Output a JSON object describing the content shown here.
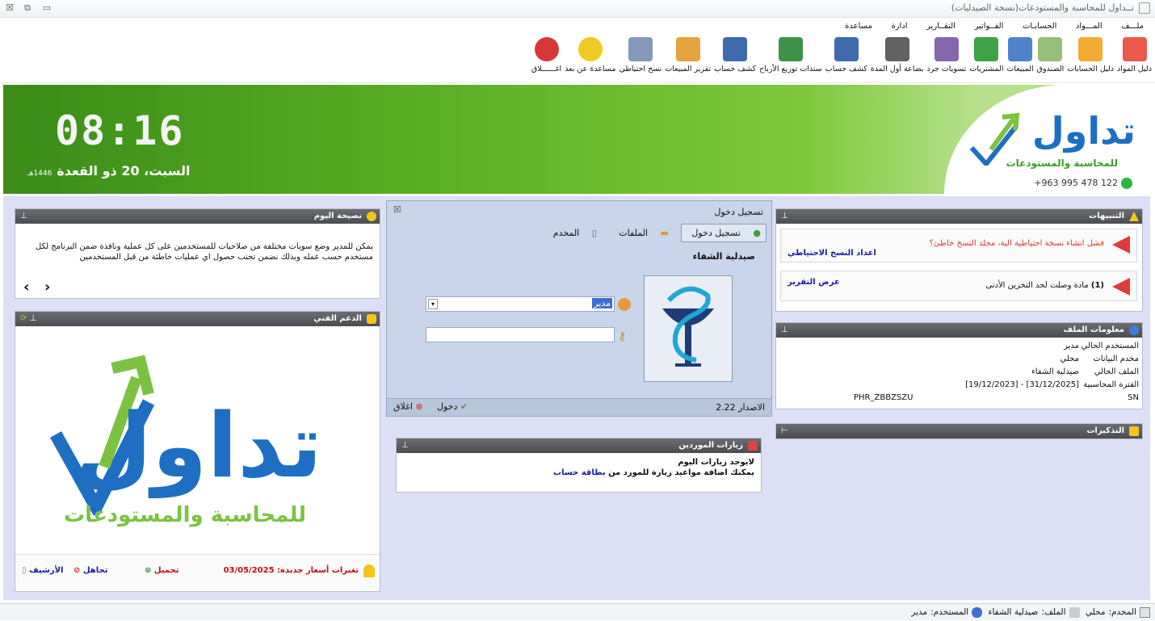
{
  "window": {
    "title": "تــداول للمحاسبة والمستودعات(نسخة الصيدليات)",
    "btn_close": "☒",
    "btn_restore": "⧉",
    "btn_minimize": "▭"
  },
  "menu": [
    "ملـــف",
    "المـــواد",
    "الحسابـات",
    "الفــواتير",
    "التقــارير",
    "ادارة",
    "مساعدة"
  ],
  "toolbar": [
    {
      "label": "دليل المواد",
      "icon": "pill-icon",
      "color": "#e94b3c"
    },
    {
      "label": "دليل الحسابات",
      "icon": "org-chart-icon",
      "color": "#f4a322"
    },
    {
      "label": "الصندوق",
      "icon": "safe-icon",
      "color": "#8fb870"
    },
    {
      "label": "المبيعات",
      "icon": "invoice-pen-icon",
      "color": "#3f78c8"
    },
    {
      "label": "المشتريات",
      "icon": "ledger-icon",
      "color": "#2e9a3a"
    },
    {
      "label": "تسويات جرد",
      "icon": "checklist-pen-icon",
      "color": "#7a5aa8"
    },
    {
      "label": "بضاعة أول المدة",
      "icon": "pencil-note-icon",
      "color": "#555555"
    },
    {
      "label": "كشف حساب",
      "icon": "user-statement-icon",
      "color": "#2d5ea5"
    },
    {
      "label": "سندات توزيع الأرباح",
      "icon": "money-book-icon",
      "color": "#2e8a3a"
    },
    {
      "label": "كشف حساب",
      "icon": "user-statement-icon",
      "color": "#2d5ea5"
    },
    {
      "label": "تقرير المبيعات",
      "icon": "bar-chart-icon",
      "color": "#e39b2a"
    },
    {
      "label": "نسخ احتياطي",
      "icon": "database-backup-icon",
      "color": "#7b8fb5"
    },
    {
      "label": "مساعدة عن بعد",
      "icon": "headset-support-icon",
      "color": "#f1c40f"
    },
    {
      "label": "اغــــــلاق",
      "icon": "power-off-icon",
      "color": "#d32626"
    }
  ],
  "banner": {
    "time": "08:16",
    "date": "السبت،  20 ذو القعدة",
    "hijri_year": "1446هـ",
    "logo_text": "تداول",
    "logo_sub": "للمحاسبة والمستودعات",
    "phone": "+963 995 478 122"
  },
  "tip": {
    "title": "نصيحة اليوم",
    "text": "يمكن للمدير وضع سويات مختلفة من صلاحيات للمستخدمين على كل عملية ونافذة ضمن البرنامج لكل مستخدم حسب عمله وبذلك نضمن تجنب حصول اي عمليات خاطئة من قبل المستخدمين",
    "prev": "‹",
    "next": "›"
  },
  "support": {
    "title": "الدعم الفني",
    "logo_text": "تداول",
    "logo_sub": "للمحاسبة والمستودعات",
    "price_notice": "تغيرات أسعار جديدة: 03/05/2025",
    "download": "تحميل",
    "ignore": "تجاهل",
    "archive": "الأرشيف"
  },
  "login": {
    "title": "تسجيل دخول",
    "tab_login": "تسجيل دخول",
    "tab_files": "الملفات",
    "tab_server": "المخدم",
    "pharmacy": "صيدلية الشفاء",
    "username": "مدير",
    "password": "",
    "version": "الاصدار  2.22",
    "enter": "دخول",
    "close": "اغلاق",
    "x": "☒"
  },
  "visits": {
    "title": "زيارات الموردين",
    "line1": "لايوجد زيارات اليوم",
    "line2": "يمكنك اضافة مواعيد زيارة للمورد من",
    "link": "بطاقة حساب"
  },
  "alerts": {
    "title": "التنبيهات",
    "items": [
      {
        "text": "فشل انشاء نسخة احتياطية الية، مجلد النسخ خاطئ؟",
        "link": "اعداد النسخ الاحتياطي",
        "color": "#d83a2c"
      },
      {
        "count": "(1)",
        "text": "مادة وصلت لحد التخزين الأدنى",
        "link": "عرض التقرير",
        "color": "#111111"
      }
    ]
  },
  "fileinfo": {
    "title": "معلومات الملف",
    "rows": [
      {
        "k": "المستخدم الحالي",
        "v": "مدير"
      },
      {
        "k": "مخدم البيانات",
        "v": "محلي"
      },
      {
        "k": "الملف الحالي",
        "v": "صيدلية الشفاء"
      },
      {
        "k": "الفترة المحاسبية",
        "v": "[19/12/2023] - [31/12/2025]"
      }
    ],
    "sn_key": "SN",
    "sn_val": "PHR_ZBBZSZU"
  },
  "reminders": {
    "title": "التذكيرات"
  },
  "status": {
    "server_label": "المخدم:",
    "server": "محلي",
    "file_label": "الملف:",
    "file": "صيدلية الشفاء",
    "user_label": "المستخدم:",
    "user": "مدير"
  }
}
